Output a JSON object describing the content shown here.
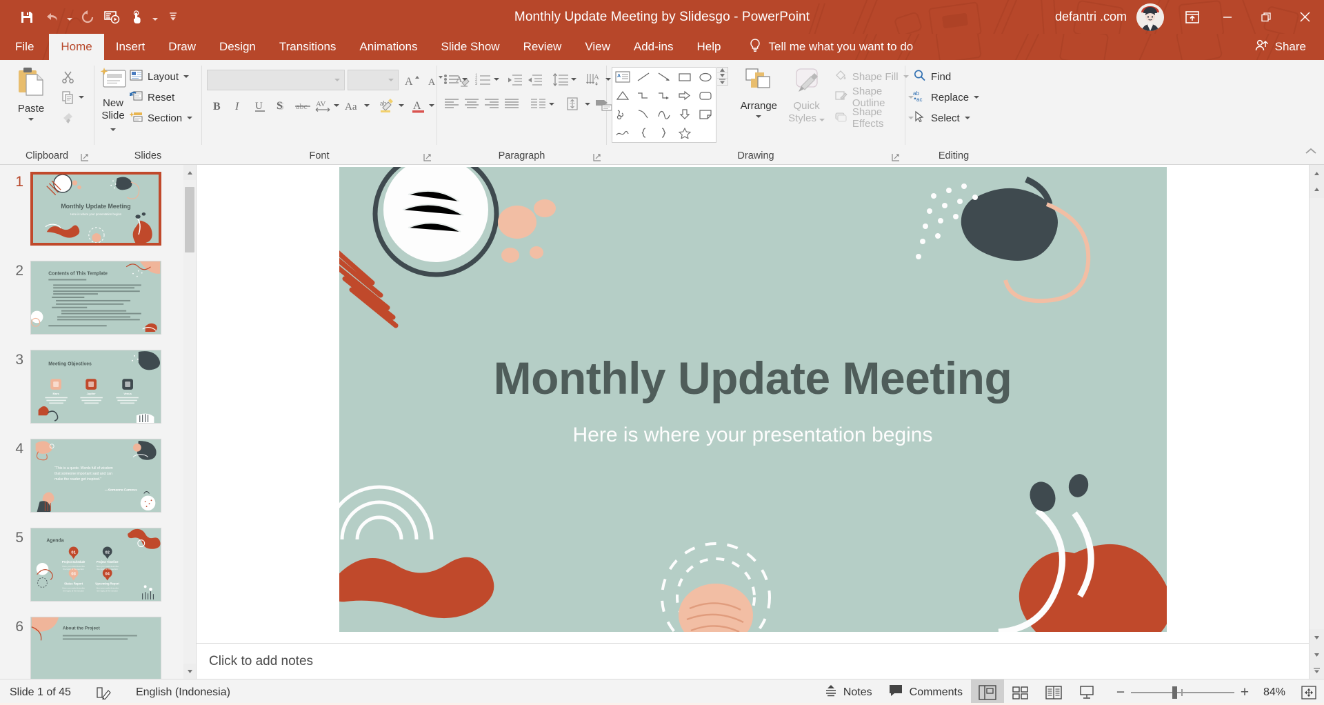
{
  "window": {
    "title": "Monthly Update Meeting by Slidesgo  -  PowerPoint",
    "account_name": "defantri .com",
    "theme_color": "#b7472a",
    "buttons": {
      "minimize": "minimize-button",
      "restore": "restore-button",
      "close": "close-button",
      "ribbon_display": "ribbon-display-options"
    }
  },
  "qat": {
    "items": [
      {
        "name": "save",
        "icon": "save-icon"
      },
      {
        "name": "undo",
        "icon": "undo-icon",
        "has_caret": true
      },
      {
        "name": "redo",
        "icon": "redo-icon"
      },
      {
        "name": "start-from-beginning",
        "icon": "slideshow-icon"
      },
      {
        "name": "touch-mouse-mode",
        "icon": "touch-mode-icon",
        "has_caret": true
      },
      {
        "name": "customize-quick-access-toolbar",
        "icon": "chevron-down-icon"
      }
    ]
  },
  "tabs": [
    {
      "label": "File",
      "active": false
    },
    {
      "label": "Home",
      "active": true
    },
    {
      "label": "Insert",
      "active": false
    },
    {
      "label": "Draw",
      "active": false
    },
    {
      "label": "Design",
      "active": false
    },
    {
      "label": "Transitions",
      "active": false
    },
    {
      "label": "Animations",
      "active": false
    },
    {
      "label": "Slide Show",
      "active": false
    },
    {
      "label": "Review",
      "active": false
    },
    {
      "label": "View",
      "active": false
    },
    {
      "label": "Add-ins",
      "active": false
    },
    {
      "label": "Help",
      "active": false
    }
  ],
  "tellme": {
    "label": "Tell me what you want to do",
    "icon": "lightbulb-icon"
  },
  "share": {
    "label": "Share",
    "icon": "share-person-icon"
  },
  "ribbon": {
    "groups": [
      {
        "label": "Clipboard",
        "paste": "Paste",
        "items": [
          "Cut",
          "Copy",
          "Format Painter"
        ]
      },
      {
        "label": "Slides",
        "new_slide": "New\nSlide",
        "new_slide_line1": "New",
        "new_slide_line2": "Slide",
        "items": [
          "Layout",
          "Reset",
          "Section"
        ]
      },
      {
        "label": "Font",
        "font_name": "",
        "font_size": "",
        "font_name_placeholder": "",
        "font_size_placeholder": "",
        "buttons": [
          "Bold",
          "Italic",
          "Underline",
          "Text Shadow",
          "Strikethrough",
          "Character Spacing",
          "Change Case",
          "Text Highlight Color",
          "Font Color",
          "Increase Font Size",
          "Decrease Font Size",
          "Clear All Formatting"
        ]
      },
      {
        "label": "Paragraph",
        "buttons": [
          "Bullets",
          "Numbering",
          "Decrease List Level",
          "Increase List Level",
          "Line Spacing",
          "Align Left",
          "Center",
          "Align Right",
          "Justify",
          "Columns",
          "Text Direction",
          "Align Text",
          "Convert to SmartArt"
        ]
      },
      {
        "label": "Drawing",
        "arrange": "Arrange",
        "quick_styles_line1": "Quick",
        "quick_styles_line2": "Styles",
        "shape_fill": "Shape Fill",
        "shape_outline": "Shape Outline",
        "shape_effects": "Shape Effects"
      },
      {
        "label": "Editing",
        "find": "Find",
        "replace": "Replace",
        "select": "Select"
      }
    ]
  },
  "thumbnails": [
    {
      "number": "1",
      "selected": true,
      "title": "Monthly Update Meeting",
      "subtitle": "Here is where your presentation begins",
      "kind": "title"
    },
    {
      "number": "2",
      "selected": false,
      "title": "Contents of This Template",
      "kind": "contents"
    },
    {
      "number": "3",
      "selected": false,
      "title": "Meeting Objectives",
      "kind": "objectives",
      "cards": [
        {
          "heading": "Mars",
          "text": "Despite being red, Mars is a cold place. It's full of iron oxide dust"
        },
        {
          "heading": "Jupiter",
          "text": "Jupiter is the biggest planet in our Solar System and the fourth brightest"
        },
        {
          "heading": "Venus",
          "text": "Venus is a beautiful name, but it's burning hot, even hotter than Mercury"
        }
      ]
    },
    {
      "number": "4",
      "selected": false,
      "kind": "quote",
      "quote": "“This is a quote. Words full of wisdom that someone important said and can make the reader get inspired.”",
      "attribution": "—Someone Famous"
    },
    {
      "number": "5",
      "selected": false,
      "title": "Agenda",
      "kind": "agenda",
      "items": [
        {
          "num": "01",
          "heading": "Project Schedule",
          "text": "Here you could describe the topic of the section"
        },
        {
          "num": "02",
          "heading": "Project Timeline",
          "text": "Here you could describe the topic of the section"
        },
        {
          "num": "03",
          "heading": "Status Report",
          "text": "Here you could describe the topic of the section"
        },
        {
          "num": "04",
          "heading": "Upcoming Report",
          "text": "Here you could describe the topic of the section"
        }
      ]
    },
    {
      "number": "6",
      "selected": false,
      "title": "About the Project",
      "kind": "about"
    }
  ],
  "slide": {
    "title": "Monthly Update Meeting",
    "subtitle": "Here is where your presentation begins",
    "background": "#b5cec6",
    "title_color": "#4f5d5a",
    "subtitle_color": "#fdfdfd"
  },
  "notes": {
    "placeholder": "Click to add notes"
  },
  "status": {
    "slide_counter": "Slide 1 of 45",
    "language": "English (Indonesia)",
    "accessibility_icon": "accessibility-checker-icon",
    "notes_label": "Notes",
    "comments_label": "Comments",
    "views": [
      {
        "name": "normal-view",
        "active": true
      },
      {
        "name": "slide-sorter-view",
        "active": false
      },
      {
        "name": "reading-view",
        "active": false
      },
      {
        "name": "slide-show-view",
        "active": false
      }
    ],
    "zoom_percent": "84%",
    "zoom_out": "−",
    "zoom_in": "+",
    "fit_to_window": "fit-slide-to-window-icon"
  }
}
